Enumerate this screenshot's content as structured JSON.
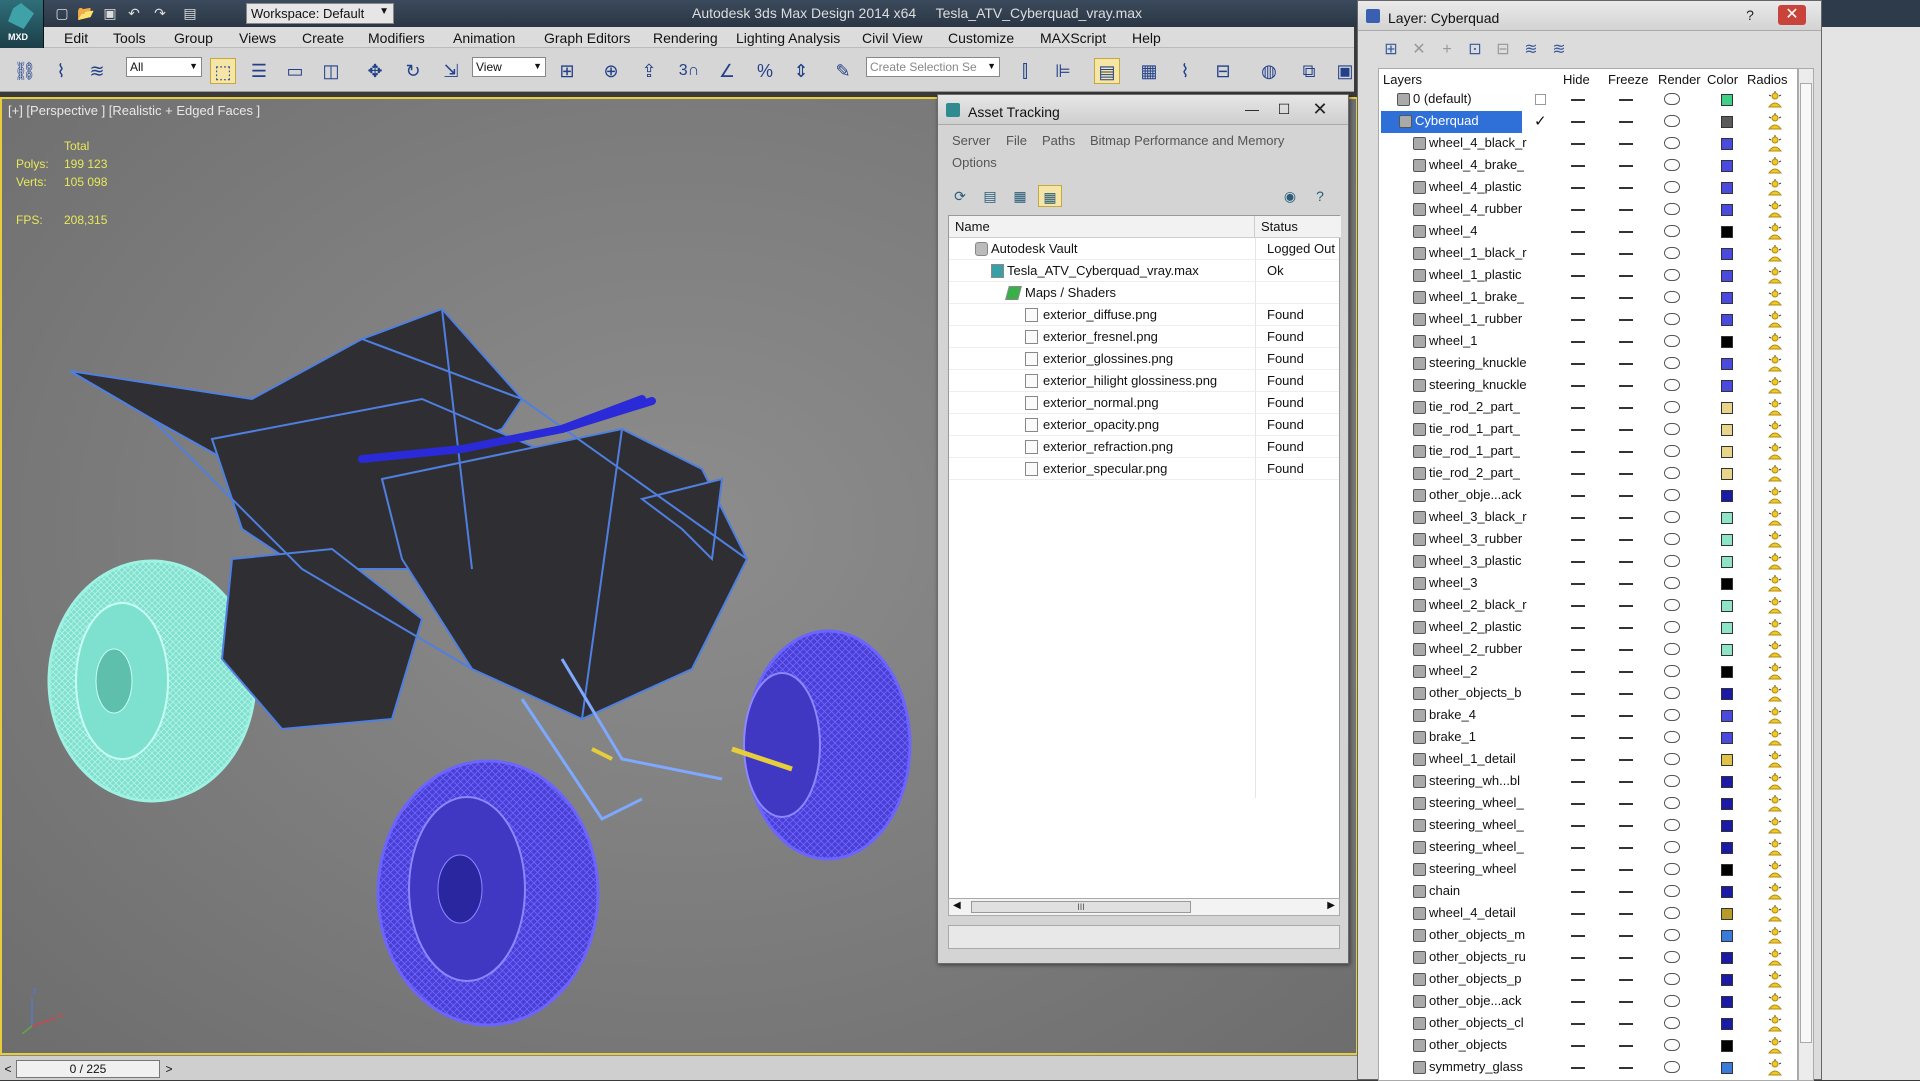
{
  "title_bar": {
    "app_title": "Autodesk 3ds Max Design 2014 x64",
    "file_title": "Tesla_ATV_Cyberquad_vray.max",
    "workspace": "Workspace: Default",
    "logo_text": "MXD"
  },
  "menu": [
    "Edit",
    "Tools",
    "Group",
    "Views",
    "Create",
    "Modifiers",
    "Animation",
    "Graph Editors",
    "Rendering",
    "Lighting Analysis",
    "Civil View",
    "Customize",
    "MAXScript",
    "Help"
  ],
  "toolbar": {
    "filter_select": "All",
    "ref_coord_select": "View",
    "selection_set_placeholder": "Create Selection Se",
    "snap_label": "3"
  },
  "viewport": {
    "label": "[+] [Perspective ] [Realistic + Edged Faces ]",
    "stats_header": "Total",
    "polys_label": "Polys:",
    "polys_value": "199 123",
    "verts_label": "Verts:",
    "verts_value": "105 098",
    "fps_label": "FPS:",
    "fps_value": "208,315",
    "axis_x": "x",
    "axis_z": "z"
  },
  "bottom": {
    "time_slider": "0 / 225",
    "prev": "<",
    "next": ">"
  },
  "asset_tracking": {
    "title": "Asset Tracking",
    "menu": {
      "server": "Server",
      "file": "File",
      "paths": "Paths",
      "bitmap": "Bitmap Performance and Memory",
      "options": "Options"
    },
    "columns": {
      "name": "Name",
      "status": "Status"
    },
    "rows": [
      {
        "name": "Autodesk Vault",
        "status": "Logged Out"
      },
      {
        "name": "Tesla_ATV_Cyberquad_vray.max",
        "status": "Ok"
      },
      {
        "name": "Maps / Shaders",
        "status": ""
      },
      {
        "name": "exterior_diffuse.png",
        "status": "Found"
      },
      {
        "name": "exterior_fresnel.png",
        "status": "Found"
      },
      {
        "name": "exterior_glossines.png",
        "status": "Found"
      },
      {
        "name": "exterior_hilight glossiness.png",
        "status": "Found"
      },
      {
        "name": "exterior_normal.png",
        "status": "Found"
      },
      {
        "name": "exterior_opacity.png",
        "status": "Found"
      },
      {
        "name": "exterior_refraction.png",
        "status": "Found"
      },
      {
        "name": "exterior_specular.png",
        "status": "Found"
      }
    ],
    "scroll_thumb": "III"
  },
  "layer_panel": {
    "title": "Layer: Cyberquad",
    "columns": {
      "layers": "Layers",
      "hide": "Hide",
      "freeze": "Freeze",
      "render": "Render",
      "color": "Color",
      "radios": "Radios"
    },
    "layers": [
      {
        "name": "0 (default)",
        "color": "#3fcf86"
      },
      {
        "name": "Cyberquad",
        "color": "#5a5a5a"
      },
      {
        "name": "wheel_4_black_r",
        "color": "#4a4adf"
      },
      {
        "name": "wheel_4_brake_",
        "color": "#4a4adf"
      },
      {
        "name": "wheel_4_plastic",
        "color": "#4a4adf"
      },
      {
        "name": "wheel_4_rubber",
        "color": "#4a4adf"
      },
      {
        "name": "wheel_4",
        "color": "#000000"
      },
      {
        "name": "wheel_1_black_r",
        "color": "#4a4adf"
      },
      {
        "name": "wheel_1_plastic",
        "color": "#4a4adf"
      },
      {
        "name": "wheel_1_brake_",
        "color": "#4a4adf"
      },
      {
        "name": "wheel_1_rubber",
        "color": "#4a4adf"
      },
      {
        "name": "wheel_1",
        "color": "#000000"
      },
      {
        "name": "steering_knuckle",
        "color": "#4a4adf"
      },
      {
        "name": "steering_knuckle",
        "color": "#4a4adf"
      },
      {
        "name": "tie_rod_2_part_",
        "color": "#e8d48a"
      },
      {
        "name": "tie_rod_1_part_",
        "color": "#e8d48a"
      },
      {
        "name": "tie_rod_1_part_",
        "color": "#e8d48a"
      },
      {
        "name": "tie_rod_2_part_",
        "color": "#e8d48a"
      },
      {
        "name": "other_obje...ack",
        "color": "#1a1aa6"
      },
      {
        "name": "wheel_3_black_r",
        "color": "#8fe3c8"
      },
      {
        "name": "wheel_3_rubber",
        "color": "#8fe3c8"
      },
      {
        "name": "wheel_3_plastic",
        "color": "#8fe3c8"
      },
      {
        "name": "wheel_3",
        "color": "#000000"
      },
      {
        "name": "wheel_2_black_r",
        "color": "#8fe3c8"
      },
      {
        "name": "wheel_2_plastic",
        "color": "#8fe3c8"
      },
      {
        "name": "wheel_2_rubber",
        "color": "#8fe3c8"
      },
      {
        "name": "wheel_2",
        "color": "#000000"
      },
      {
        "name": "other_objects_b",
        "color": "#1a1aa6"
      },
      {
        "name": "brake_4",
        "color": "#4a4adf"
      },
      {
        "name": "brake_1",
        "color": "#4a4adf"
      },
      {
        "name": "wheel_1_detail",
        "color": "#e0c24a"
      },
      {
        "name": "steering_wh...bl",
        "color": "#1a1aa6"
      },
      {
        "name": "steering_wheel_",
        "color": "#1a1aa6"
      },
      {
        "name": "steering_wheel_",
        "color": "#1a1aa6"
      },
      {
        "name": "steering_wheel_",
        "color": "#1a1aa6"
      },
      {
        "name": "steering_wheel",
        "color": "#000000"
      },
      {
        "name": "chain",
        "color": "#1a1aa6"
      },
      {
        "name": "wheel_4_detail",
        "color": "#b89a2a"
      },
      {
        "name": "other_objects_m",
        "color": "#3a7ad8"
      },
      {
        "name": "other_objects_ru",
        "color": "#1a1aa6"
      },
      {
        "name": "other_objects_p",
        "color": "#1a1aa6"
      },
      {
        "name": "other_obje...ack",
        "color": "#1a1aa6"
      },
      {
        "name": "other_objects_cl",
        "color": "#1a1aa6"
      },
      {
        "name": "other_objects",
        "color": "#000000"
      },
      {
        "name": "symmetry_glass",
        "color": "#3a7ad8"
      }
    ]
  }
}
